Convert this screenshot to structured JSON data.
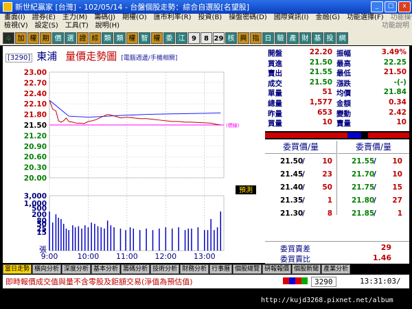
{
  "window": {
    "title": "新世紀贏家 [台灣] - 102/05/14 - 台盤個股走勢：綜合自選股[名望股]",
    "buttons": [
      "_",
      "□",
      "x"
    ]
  },
  "menu": {
    "row1": [
      "畫面(I)",
      "證券(E)",
      "主力(M)",
      "籌碼(J)",
      "期權(O)",
      "匯市利率(R)",
      "投資(B)",
      "操盤密碼(D)",
      "國際資訊(I)",
      "金融(G)",
      "功能選擇(F)"
    ],
    "row1_right": "功能操作(A)",
    "row2": [
      "檢視(V)",
      "設定(S)",
      "工具(T)",
      "說明(H)"
    ],
    "row2_right": "功能說明"
  },
  "toolbar": [
    {
      "t": "♤",
      "c": "k"
    },
    {
      "t": "加",
      "c": "o"
    },
    {
      "t": "權",
      "c": "o"
    },
    {
      "t": "期",
      "c": "o"
    },
    {
      "t": "價",
      "c": "t"
    },
    {
      "t": "選",
      "c": "t"
    },
    {
      "t": "證",
      "c": "o"
    },
    {
      "t": "綜",
      "c": "o"
    },
    {
      "t": "類",
      "c": "t"
    },
    {
      "t": "類",
      "c": "t"
    },
    {
      "t": "權",
      "c": "o"
    },
    {
      "t": "智",
      "c": "t"
    },
    {
      "t": "權",
      "c": "o"
    },
    {
      "t": "委",
      "c": "t"
    },
    {
      "t": "江",
      "c": "t"
    },
    {
      "t": "9",
      "c": "n"
    },
    {
      "t": "8",
      "c": "n"
    },
    {
      "t": "29",
      "c": "n"
    },
    {
      "t": "核",
      "c": "t"
    },
    {
      "t": "興",
      "c": "o"
    },
    {
      "t": "指",
      "c": "o"
    },
    {
      "t": "日",
      "c": "t"
    },
    {
      "t": "驗",
      "c": "t"
    },
    {
      "t": "產",
      "c": "t"
    },
    {
      "t": "財",
      "c": "t"
    },
    {
      "t": "基",
      "c": "t"
    },
    {
      "t": "投",
      "c": "t"
    },
    {
      "t": "網",
      "c": "t"
    }
  ],
  "stock": {
    "code": "[3290]",
    "name": "東浦",
    "chart_title": "量價走勢圖",
    "chart_subtitle": "[電腦週邊/手機相關]",
    "predict_label": "預測",
    "ref_label": "(標線)"
  },
  "quote": [
    {
      "l1": "開盤",
      "v1": "22.20",
      "c1": "#c00000",
      "l2": "振幅",
      "v2": "3.49%",
      "c2": "#c00000"
    },
    {
      "l1": "買進",
      "v1": "21.50",
      "c1": "#008000",
      "l2": "最高",
      "v2": "22.25",
      "c2": "#008000"
    },
    {
      "l1": "賣出",
      "v1": "21.55",
      "c1": "#008000",
      "l2": "最低",
      "v2": "21.50",
      "c2": "#c00000"
    },
    {
      "l1": "成交",
      "v1": "21.50",
      "c1": "#008000",
      "l2": "漲跌",
      "v2": "-(-)",
      "c2": "#008000"
    },
    {
      "l1": "單量",
      "v1": "51",
      "c1": "#c00000",
      "l2": "均價",
      "v2": "21.84",
      "c2": "#008000"
    },
    {
      "l1": "總量",
      "v1": "1,577",
      "c1": "#c00000",
      "l2": "金額",
      "v2": "0.34",
      "c2": "#c00000"
    },
    {
      "l1": "昨量",
      "v1": "653",
      "c1": "#c00000",
      "l2": "變動",
      "v2": "2.42",
      "c2": "#c00000"
    },
    {
      "l1": "買量",
      "v1": "10",
      "c1": "#c00000",
      "l2": "賣量",
      "v2": "10",
      "c2": "#c00000"
    }
  ],
  "orderbook": {
    "bid_header": "委買價/量",
    "ask_header": "委賣價/量",
    "rows": [
      {
        "bp": "21.50",
        "bv": "10",
        "ap": "21.55",
        "av": "10"
      },
      {
        "bp": "21.45",
        "bv": "23",
        "ap": "21.70",
        "av": "10"
      },
      {
        "bp": "21.40",
        "bv": "50",
        "ap": "21.75",
        "av": "15"
      },
      {
        "bp": "21.35",
        "bv": "1",
        "ap": "21.80",
        "av": "27"
      },
      {
        "bp": "21.30",
        "bv": "8",
        "ap": "21.85",
        "av": "1"
      }
    ]
  },
  "summary": {
    "diff_label": "委買賣差",
    "diff_value": "29",
    "ratio_label": "委買賣比",
    "ratio_value": "1.46"
  },
  "tabs": [
    "當日走勢",
    "橫向分析",
    "深度分析",
    "基本分析",
    "籌碼分析",
    "技術分析",
    "財務分析",
    "行事曆",
    "個股總覽",
    "研報報價",
    "個股新聞",
    "產業分析"
  ],
  "status": {
    "message": "即時報價成交值與量不含零股及鉅額交易(淨值為預估值)",
    "code": "3290",
    "time": "13:31:03/"
  },
  "url": "http://kujd3268.pixnet.net/album",
  "colors": {
    "accent": "#c00000",
    "blue": "#000080",
    "price_line": "#c00000",
    "avg_line": "#2020ff",
    "ref_line": "#ff00ff",
    "volume": "#0000c0"
  },
  "chart_data": {
    "type": "line",
    "xlabels": [
      "9:00",
      "10:00",
      "11:00",
      "12:00",
      "13:00"
    ],
    "price_ticks": [
      "23.00",
      "22.70",
      "22.40",
      "22.10",
      "21.80",
      "21.50",
      "21.20",
      "20.90",
      "20.60",
      "20.30",
      "20.00"
    ],
    "price_ylim": [
      20.0,
      23.0
    ],
    "reference_price": 21.5,
    "volume_ticks": [
      "3,000",
      "1,000",
      "500",
      "200",
      "80",
      "50",
      "25",
      "15"
    ],
    "volume_unit": "張",
    "price_series": {
      "name": "成交價",
      "x_minutes": [
        0,
        5,
        10,
        14,
        18,
        22,
        26,
        30,
        36,
        42,
        48,
        54,
        60,
        66,
        72,
        80,
        90,
        100,
        110,
        120,
        130,
        140,
        150,
        160,
        170,
        180,
        190,
        200,
        210,
        220,
        230,
        240,
        250,
        258,
        265
      ],
      "values": [
        22.2,
        21.95,
        21.9,
        21.62,
        21.58,
        21.62,
        21.7,
        21.6,
        21.58,
        21.55,
        21.55,
        21.54,
        21.6,
        21.62,
        21.65,
        21.72,
        21.8,
        21.76,
        21.7,
        21.72,
        21.7,
        21.68,
        21.68,
        21.66,
        21.64,
        21.62,
        21.6,
        21.6,
        21.58,
        21.58,
        21.57,
        21.56,
        21.55,
        21.52,
        21.5
      ]
    },
    "avg_series": {
      "name": "均價",
      "x_minutes": [
        0,
        30,
        60,
        100,
        150,
        200,
        265
      ],
      "values": [
        22.2,
        21.75,
        21.72,
        21.76,
        21.8,
        21.82,
        21.84
      ]
    },
    "volume": {
      "x_minutes": [
        0,
        5,
        10,
        14,
        18,
        22,
        26,
        30,
        36,
        40,
        45,
        50,
        55,
        60,
        65,
        70,
        75,
        80,
        85,
        90,
        95,
        100,
        110,
        118,
        125,
        130,
        140,
        150,
        160,
        170,
        180,
        190,
        200,
        210,
        215,
        220,
        230,
        240,
        245,
        250,
        255,
        260,
        265
      ],
      "values": [
        300,
        60,
        200,
        120,
        100,
        50,
        25,
        20,
        40,
        30,
        35,
        25,
        40,
        30,
        60,
        50,
        35,
        30,
        25,
        80,
        40,
        30,
        25,
        20,
        30,
        25,
        20,
        25,
        20,
        25,
        30,
        25,
        30,
        20,
        25,
        25,
        30,
        20,
        20,
        100,
        20,
        30,
        300
      ]
    }
  }
}
